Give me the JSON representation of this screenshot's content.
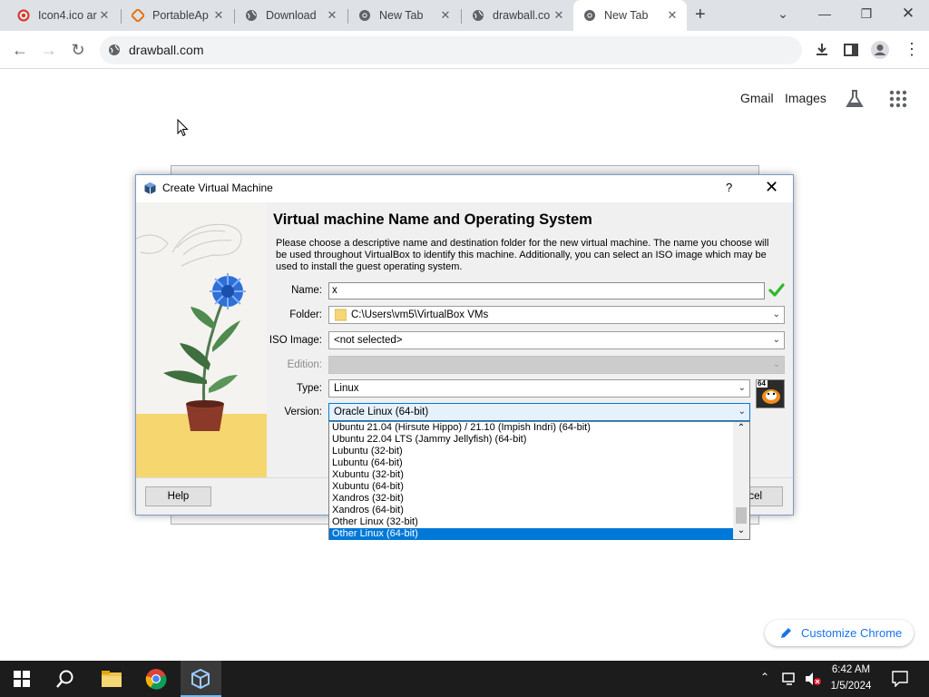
{
  "browser": {
    "tabs": [
      {
        "label": "Icon4.ico ar",
        "icon": "icon4-favicon"
      },
      {
        "label": "PortableAp",
        "icon": "portableapps-favicon"
      },
      {
        "label": "Download",
        "icon": "globe-icon"
      },
      {
        "label": "New Tab",
        "icon": "chrome-icon"
      },
      {
        "label": "drawball.co",
        "icon": "globe-icon"
      },
      {
        "label": "New Tab",
        "icon": "chrome-icon"
      }
    ],
    "active_tab_index": 5,
    "address": "drawball.com"
  },
  "google": {
    "gmail": "Gmail",
    "images": "Images"
  },
  "dialog": {
    "title": "Create Virtual Machine",
    "help_glyph": "?",
    "heading": "Virtual machine Name and Operating System",
    "description": "Please choose a descriptive name and destination folder for the new virtual machine. The name you choose will be used throughout VirtualBox to identify this machine. Additionally, you can select an ISO image which may be used to install the guest operating system.",
    "name_label": "Name:",
    "name_value": "x",
    "folder_label": "Folder:",
    "folder_value": "C:\\Users\\vm5\\VirtualBox VMs",
    "iso_label": "ISO Image:",
    "iso_value": "<not selected>",
    "edition_label": "Edition:",
    "edition_value": "",
    "type_label": "Type:",
    "type_value": "Linux",
    "version_label": "Version:",
    "version_value": "Oracle Linux (64-bit)",
    "version_options": [
      "Ubuntu 21.04 (Hirsute Hippo) / 21.10 (Impish Indri) (64-bit)",
      "Ubuntu 22.04 LTS (Jammy Jellyfish) (64-bit)",
      "Lubuntu (32-bit)",
      "Lubuntu (64-bit)",
      "Xubuntu (32-bit)",
      "Xubuntu (64-bit)",
      "Xandros (32-bit)",
      "Xandros (64-bit)",
      "Other Linux (32-bit)",
      "Other Linux (64-bit)"
    ],
    "selected_option_index": 9,
    "os_badge": "64",
    "help_button": "Help",
    "cancel_button": "ncel"
  },
  "customize_chrome": "Customize Chrome",
  "taskbar": {
    "time": "6:42 AM",
    "date": "1/5/2024"
  },
  "colors": {
    "accent": "#0078d7",
    "chrome_blue": "#1a73e8",
    "valid_check": "#2eb82e"
  }
}
